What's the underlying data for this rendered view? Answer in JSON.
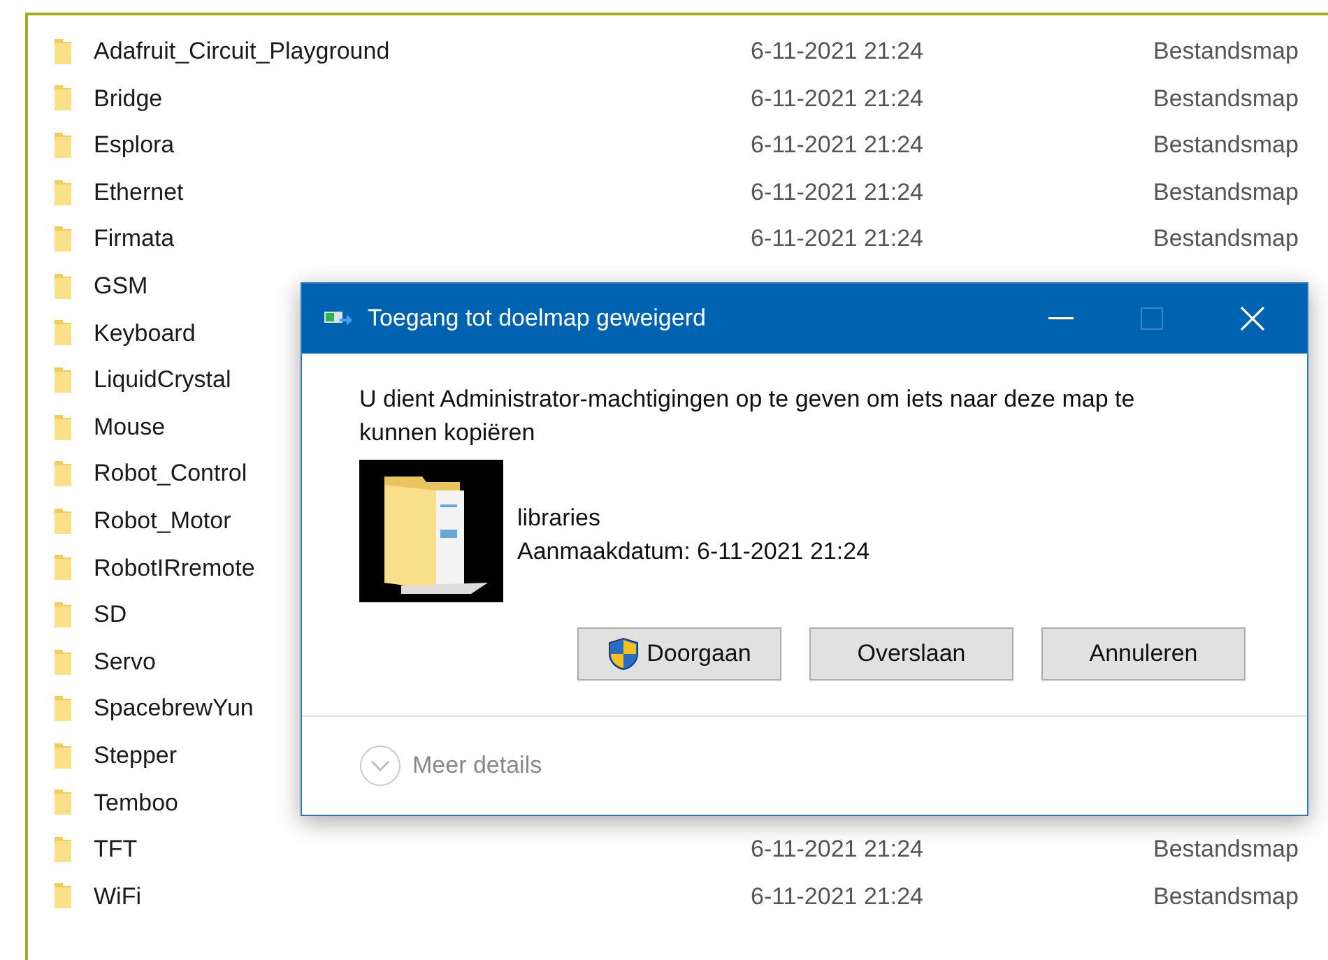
{
  "files": [
    {
      "name": "Adafruit_Circuit_Playground",
      "date": "6-11-2021 21:24",
      "type": "Bestandsmap"
    },
    {
      "name": "Bridge",
      "date": "6-11-2021 21:24",
      "type": "Bestandsmap"
    },
    {
      "name": "Esplora",
      "date": "6-11-2021 21:24",
      "type": "Bestandsmap"
    },
    {
      "name": "Ethernet",
      "date": "6-11-2021 21:24",
      "type": "Bestandsmap"
    },
    {
      "name": "Firmata",
      "date": "6-11-2021 21:24",
      "type": "Bestandsmap"
    },
    {
      "name": "GSM"
    },
    {
      "name": "Keyboard"
    },
    {
      "name": "LiquidCrystal"
    },
    {
      "name": "Mouse"
    },
    {
      "name": "Robot_Control"
    },
    {
      "name": "Robot_Motor"
    },
    {
      "name": "RobotIRremote"
    },
    {
      "name": "SD"
    },
    {
      "name": "Servo"
    },
    {
      "name": "SpacebrewYun"
    },
    {
      "name": "Stepper"
    },
    {
      "name": "Temboo"
    },
    {
      "name": "TFT",
      "date": "6-11-2021 21:24",
      "type": "Bestandsmap"
    },
    {
      "name": "WiFi",
      "date": "6-11-2021 21:24",
      "type": "Bestandsmap"
    }
  ],
  "dialog": {
    "title": "Toegang tot doelmap geweigerd",
    "message": "U dient Administrator-machtigingen op te geven om iets naar deze map te kunnen kopiëren",
    "item_name": "libraries",
    "item_date": "Aanmaakdatum: 6-11-2021 21:24",
    "buttons": [
      {
        "label": "Doorgaan",
        "kind": "shield"
      },
      {
        "label": "Overslaan",
        "kind": "plain"
      },
      {
        "label": "Annuleren",
        "kind": "plain"
      }
    ],
    "details": "Meer details"
  }
}
